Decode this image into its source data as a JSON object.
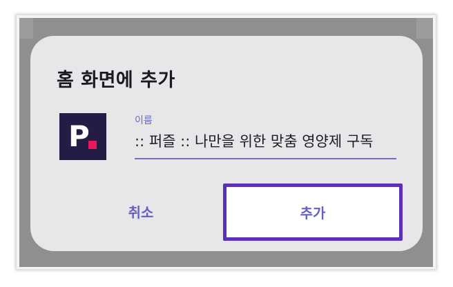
{
  "dialog": {
    "title": "홈 화면에 추가",
    "app_icon": {
      "letter": "P",
      "colors": {
        "background": "#241c45",
        "letter": "#ffffff",
        "dot": "#e8195c"
      }
    },
    "name_field": {
      "label": "이름",
      "value": ":: 퍼즐 :: 나만을 위한 맞춤 영양제 구독"
    },
    "buttons": {
      "cancel": "취소",
      "add": "추가"
    }
  },
  "colors": {
    "accent": "#6461c0",
    "highlight_border": "#5a30b6",
    "dialog_bg": "#e7e7ea",
    "scrim": "#8f8f8f"
  }
}
